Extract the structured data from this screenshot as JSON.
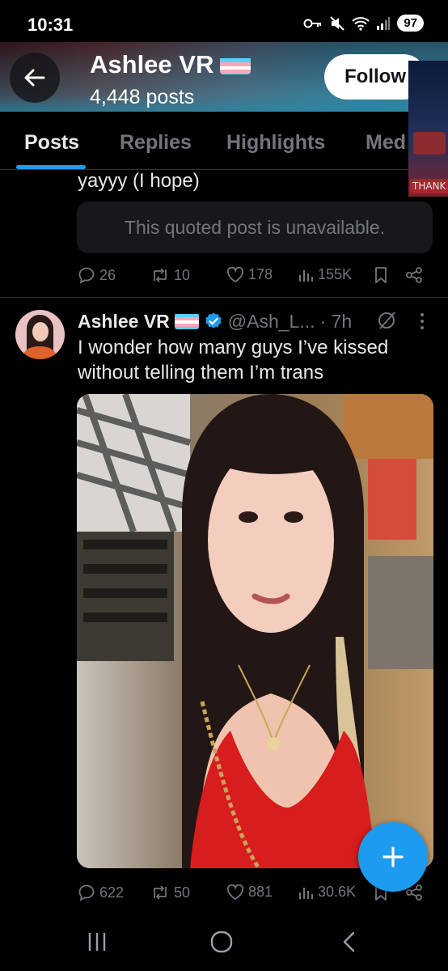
{
  "status_bar": {
    "time": "10:31",
    "battery": "97"
  },
  "header": {
    "back_icon": "arrow-left-icon",
    "profile_name": "Ashlee VR",
    "posts_count": "4,448 posts",
    "follow_label": "Follow"
  },
  "tabs": [
    {
      "label": "Posts",
      "active": true
    },
    {
      "label": "Replies",
      "active": false
    },
    {
      "label": "Highlights",
      "active": false
    },
    {
      "label": "Med",
      "active": false
    }
  ],
  "pip": {
    "label": "THANK"
  },
  "tweet1": {
    "text": "yayyy (I hope)",
    "quoted_notice": "This quoted post is unavailable.",
    "replies": "26",
    "reposts": "10",
    "likes": "178",
    "views": "155K"
  },
  "tweet2": {
    "author": "Ashlee VR",
    "handle": "@Ash_L...",
    "time": "· 7h",
    "text": "I wonder how many guys I’ve kissed without telling them I’m trans",
    "replies": "622",
    "reposts": "50",
    "likes": "881",
    "views": "30.6K"
  },
  "colors": {
    "accent": "#1d9bf0",
    "muted": "#71767b",
    "background": "#000000"
  }
}
